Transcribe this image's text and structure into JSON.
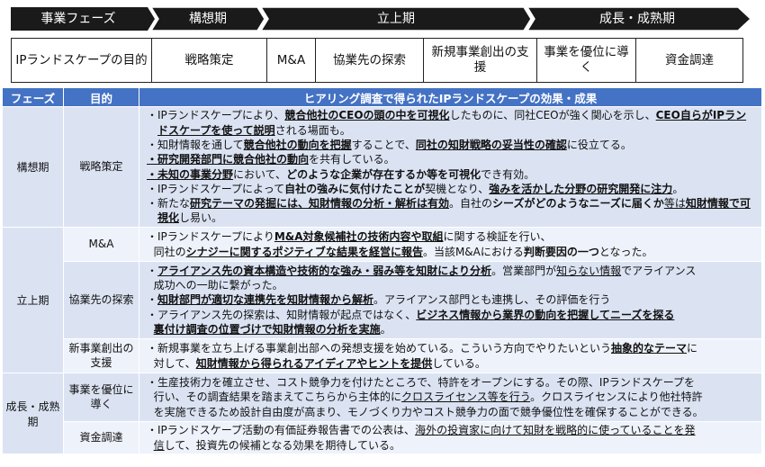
{
  "phases_bar": {
    "header": "事業フェーズ",
    "phase1": "構想期",
    "phase2": "立上期",
    "phase3": "成長・成熟期"
  },
  "purpose_row": {
    "header": "IPランドスケープの目的",
    "items": [
      "戦略策定",
      "M&A",
      "協業先の探索",
      "新規事業創出の支援",
      "事業を優位に導く",
      "資金調達"
    ]
  },
  "table": {
    "col_phase": "フェーズ",
    "col_purpose": "目的",
    "col_effect": "ヒアリング調査で得られたIPランドスケープの効果・成果",
    "rows": {
      "r1": {
        "phase": "構想期",
        "purpose": "戦略策定",
        "lines": {
          "l1a": "・IPランドスケープにより、",
          "l1b": "競合他社のCEOの頭の中を可視化",
          "l1c": "したものに、同社CEOが強く関心を示し、",
          "l1d": "CEO自ら",
          "l1e": "がIPランドスケープを使って説明",
          "l1f": "される場面も。",
          "l2a": "・知財情報を通して",
          "l2b": "競合他社の動向を把握",
          "l2c": "することで、",
          "l2d": "同社の知財戦略の妥当性の確認",
          "l2e": "に役立てる。",
          "l3a": "・研究開発部門に競合他社の動向",
          "l3b": "を共有している。",
          "l4a": "・未知の事業分野",
          "l4b": "において、",
          "l4c": "どのような企業が存在するか等を可視化",
          "l4d": "でき有効。",
          "l5a": "・IPランドスケープによって",
          "l5b": "自社の強みに気付けたことが",
          "l5c": "契機となり、",
          "l5d": "強みを活かした分野の研究開発に注力",
          "l5e": "。",
          "l6a": "・新たな",
          "l6b": "研究テーマの発掘には、知財情報の分析・解析は有効",
          "l6c": "。自社の",
          "l6d": "シーズがどのようなニーズに届くか",
          "l6e": "等は",
          "l6f": "知財情報で可視化",
          "l6g": "し易い。"
        }
      },
      "r2": {
        "phase": "立上期",
        "purpose": "M&A",
        "lines": {
          "l1a": "・IPランドスケープにより",
          "l1b": "M&A対象候補社の技術内容や取組",
          "l1c": "に関する検証を行い、",
          "l2a": "同社の",
          "l2b": "シナジーに関するポジティブな結果を経営に報告",
          "l2c": "。当該M&Aにおける",
          "l2d": "判断要因の一つ",
          "l2e": "となった。"
        }
      },
      "r3": {
        "purpose": "協業先の探索",
        "lines": {
          "l1a": "・",
          "l1b": "アライアンス先の資本構造や技術的な強み・弱み等を知財により分析",
          "l1c": "。営業部門が",
          "l1d": "知らない情報",
          "l1e": "でアライアンス",
          "l2a": "成功への一助に繋がった。",
          "l3a": "・",
          "l3b": "知財部門が適切な連携先を知財情報から解析",
          "l3c": "。アライアンス部門とも連携し、その評価を行う",
          "l4a": "・アライアンス先の探索は、知財情報が起点ではなく、",
          "l4b": "ビジネス情報から業界の動向を把握してニーズを探る",
          "l5a": "裏付け調査の位置づけで知財情報の分析を実施",
          "l5b": "。"
        }
      },
      "r4": {
        "purpose": "新事業創出の支援",
        "lines": {
          "l1a": "・新規事業を立ち上げる事業創出部への発想支援を始めている。こういう方向でやりたいという",
          "l1b": "抽象的なテーマ",
          "l1c": "に",
          "l2a": "対して、",
          "l2b": "知財情報から得られるアイディアやヒントを提供",
          "l2c": "している。"
        }
      },
      "r5": {
        "phase": "成長・成熟期",
        "purpose": "事業を優位に導く",
        "lines": {
          "l1a": "・生産技術力を確立させ、コスト競争力を付けたところで、特許をオープンにする。その際、IPランドスケープを",
          "l2a": "行い、その調査結果を踏まえてこちらから主体的に",
          "l2b": "クロスライセンス等を行う",
          "l2c": "。クロスライセンスにより他社特許",
          "l3a": "を実施できるため設計自由度が高まり、モノづくり力やコスト競争力の面で競争優位性を確保することができる。"
        }
      },
      "r6": {
        "purpose": "資金調達",
        "lines": {
          "l1a": "・IPランドスケープ活動の有価証券報告書での公表は、",
          "l1b": "海外の投資家に向けて知財を戦略的に使っていることを発",
          "l2a": "信",
          "l2b": "して、投資先の候補となる効果を期待している。"
        }
      }
    }
  }
}
